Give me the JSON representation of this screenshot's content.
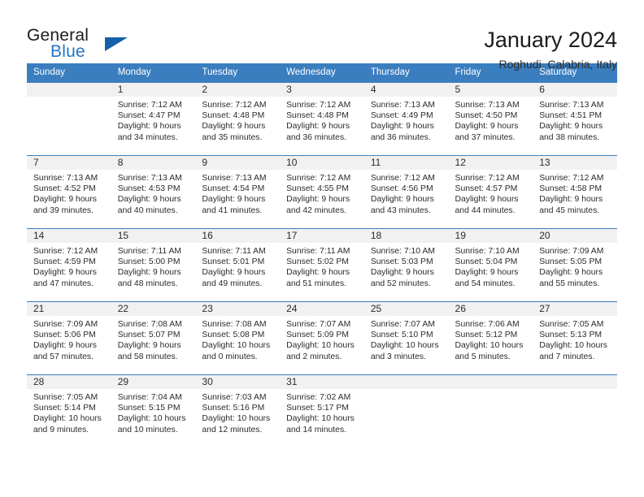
{
  "brand": {
    "name_part1": "General",
    "name_part2": "Blue",
    "triangle_color": "#1461a8",
    "blue_color": "#2476c4"
  },
  "header": {
    "title": "January 2024",
    "subtitle": "Roghudi, Calabria, Italy"
  },
  "theme": {
    "header_bg": "#3a7ebf",
    "header_text": "#ffffff",
    "daynum_band_bg": "#f1f1f1",
    "row_border": "#3a7ebf"
  },
  "labels": {
    "sunrise_prefix": "Sunrise:",
    "sunset_prefix": "Sunset:",
    "daylight_prefix": "Daylight:"
  },
  "weekdays": [
    "Sunday",
    "Monday",
    "Tuesday",
    "Wednesday",
    "Thursday",
    "Friday",
    "Saturday"
  ],
  "weeks": [
    [
      {
        "day": "",
        "empty": true
      },
      {
        "day": "1",
        "sunrise": "Sunrise: 7:12 AM",
        "sunset": "Sunset: 4:47 PM",
        "daylight1": "Daylight: 9 hours",
        "daylight2": "and 34 minutes."
      },
      {
        "day": "2",
        "sunrise": "Sunrise: 7:12 AM",
        "sunset": "Sunset: 4:48 PM",
        "daylight1": "Daylight: 9 hours",
        "daylight2": "and 35 minutes."
      },
      {
        "day": "3",
        "sunrise": "Sunrise: 7:12 AM",
        "sunset": "Sunset: 4:48 PM",
        "daylight1": "Daylight: 9 hours",
        "daylight2": "and 36 minutes."
      },
      {
        "day": "4",
        "sunrise": "Sunrise: 7:13 AM",
        "sunset": "Sunset: 4:49 PM",
        "daylight1": "Daylight: 9 hours",
        "daylight2": "and 36 minutes."
      },
      {
        "day": "5",
        "sunrise": "Sunrise: 7:13 AM",
        "sunset": "Sunset: 4:50 PM",
        "daylight1": "Daylight: 9 hours",
        "daylight2": "and 37 minutes."
      },
      {
        "day": "6",
        "sunrise": "Sunrise: 7:13 AM",
        "sunset": "Sunset: 4:51 PM",
        "daylight1": "Daylight: 9 hours",
        "daylight2": "and 38 minutes."
      }
    ],
    [
      {
        "day": "7",
        "sunrise": "Sunrise: 7:13 AM",
        "sunset": "Sunset: 4:52 PM",
        "daylight1": "Daylight: 9 hours",
        "daylight2": "and 39 minutes."
      },
      {
        "day": "8",
        "sunrise": "Sunrise: 7:13 AM",
        "sunset": "Sunset: 4:53 PM",
        "daylight1": "Daylight: 9 hours",
        "daylight2": "and 40 minutes."
      },
      {
        "day": "9",
        "sunrise": "Sunrise: 7:13 AM",
        "sunset": "Sunset: 4:54 PM",
        "daylight1": "Daylight: 9 hours",
        "daylight2": "and 41 minutes."
      },
      {
        "day": "10",
        "sunrise": "Sunrise: 7:12 AM",
        "sunset": "Sunset: 4:55 PM",
        "daylight1": "Daylight: 9 hours",
        "daylight2": "and 42 minutes."
      },
      {
        "day": "11",
        "sunrise": "Sunrise: 7:12 AM",
        "sunset": "Sunset: 4:56 PM",
        "daylight1": "Daylight: 9 hours",
        "daylight2": "and 43 minutes."
      },
      {
        "day": "12",
        "sunrise": "Sunrise: 7:12 AM",
        "sunset": "Sunset: 4:57 PM",
        "daylight1": "Daylight: 9 hours",
        "daylight2": "and 44 minutes."
      },
      {
        "day": "13",
        "sunrise": "Sunrise: 7:12 AM",
        "sunset": "Sunset: 4:58 PM",
        "daylight1": "Daylight: 9 hours",
        "daylight2": "and 45 minutes."
      }
    ],
    [
      {
        "day": "14",
        "sunrise": "Sunrise: 7:12 AM",
        "sunset": "Sunset: 4:59 PM",
        "daylight1": "Daylight: 9 hours",
        "daylight2": "and 47 minutes."
      },
      {
        "day": "15",
        "sunrise": "Sunrise: 7:11 AM",
        "sunset": "Sunset: 5:00 PM",
        "daylight1": "Daylight: 9 hours",
        "daylight2": "and 48 minutes."
      },
      {
        "day": "16",
        "sunrise": "Sunrise: 7:11 AM",
        "sunset": "Sunset: 5:01 PM",
        "daylight1": "Daylight: 9 hours",
        "daylight2": "and 49 minutes."
      },
      {
        "day": "17",
        "sunrise": "Sunrise: 7:11 AM",
        "sunset": "Sunset: 5:02 PM",
        "daylight1": "Daylight: 9 hours",
        "daylight2": "and 51 minutes."
      },
      {
        "day": "18",
        "sunrise": "Sunrise: 7:10 AM",
        "sunset": "Sunset: 5:03 PM",
        "daylight1": "Daylight: 9 hours",
        "daylight2": "and 52 minutes."
      },
      {
        "day": "19",
        "sunrise": "Sunrise: 7:10 AM",
        "sunset": "Sunset: 5:04 PM",
        "daylight1": "Daylight: 9 hours",
        "daylight2": "and 54 minutes."
      },
      {
        "day": "20",
        "sunrise": "Sunrise: 7:09 AM",
        "sunset": "Sunset: 5:05 PM",
        "daylight1": "Daylight: 9 hours",
        "daylight2": "and 55 minutes."
      }
    ],
    [
      {
        "day": "21",
        "sunrise": "Sunrise: 7:09 AM",
        "sunset": "Sunset: 5:06 PM",
        "daylight1": "Daylight: 9 hours",
        "daylight2": "and 57 minutes."
      },
      {
        "day": "22",
        "sunrise": "Sunrise: 7:08 AM",
        "sunset": "Sunset: 5:07 PM",
        "daylight1": "Daylight: 9 hours",
        "daylight2": "and 58 minutes."
      },
      {
        "day": "23",
        "sunrise": "Sunrise: 7:08 AM",
        "sunset": "Sunset: 5:08 PM",
        "daylight1": "Daylight: 10 hours",
        "daylight2": "and 0 minutes."
      },
      {
        "day": "24",
        "sunrise": "Sunrise: 7:07 AM",
        "sunset": "Sunset: 5:09 PM",
        "daylight1": "Daylight: 10 hours",
        "daylight2": "and 2 minutes."
      },
      {
        "day": "25",
        "sunrise": "Sunrise: 7:07 AM",
        "sunset": "Sunset: 5:10 PM",
        "daylight1": "Daylight: 10 hours",
        "daylight2": "and 3 minutes."
      },
      {
        "day": "26",
        "sunrise": "Sunrise: 7:06 AM",
        "sunset": "Sunset: 5:12 PM",
        "daylight1": "Daylight: 10 hours",
        "daylight2": "and 5 minutes."
      },
      {
        "day": "27",
        "sunrise": "Sunrise: 7:05 AM",
        "sunset": "Sunset: 5:13 PM",
        "daylight1": "Daylight: 10 hours",
        "daylight2": "and 7 minutes."
      }
    ],
    [
      {
        "day": "28",
        "sunrise": "Sunrise: 7:05 AM",
        "sunset": "Sunset: 5:14 PM",
        "daylight1": "Daylight: 10 hours",
        "daylight2": "and 9 minutes."
      },
      {
        "day": "29",
        "sunrise": "Sunrise: 7:04 AM",
        "sunset": "Sunset: 5:15 PM",
        "daylight1": "Daylight: 10 hours",
        "daylight2": "and 10 minutes."
      },
      {
        "day": "30",
        "sunrise": "Sunrise: 7:03 AM",
        "sunset": "Sunset: 5:16 PM",
        "daylight1": "Daylight: 10 hours",
        "daylight2": "and 12 minutes."
      },
      {
        "day": "31",
        "sunrise": "Sunrise: 7:02 AM",
        "sunset": "Sunset: 5:17 PM",
        "daylight1": "Daylight: 10 hours",
        "daylight2": "and 14 minutes."
      },
      {
        "day": "",
        "empty": true
      },
      {
        "day": "",
        "empty": true
      },
      {
        "day": "",
        "empty": true
      }
    ]
  ]
}
